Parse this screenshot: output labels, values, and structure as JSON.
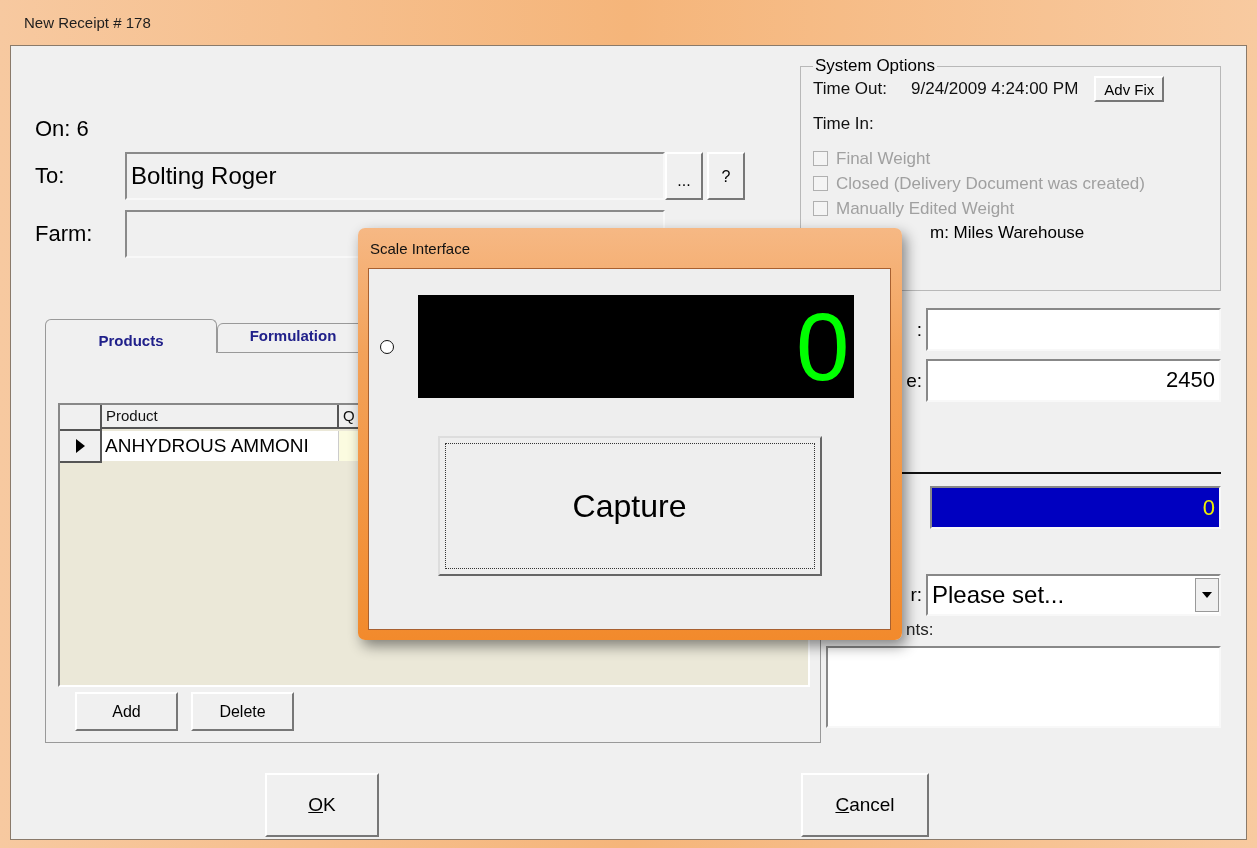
{
  "window": {
    "title": "New Receipt # 178"
  },
  "header": {
    "on_label": "On:",
    "on_value": "6",
    "to_label": "To:",
    "to_value": "Bolting Roger",
    "browse_button": "...",
    "help_button": "?",
    "farm_label": "Farm:"
  },
  "system_options": {
    "title": "System Options",
    "time_out_label": "Time Out:",
    "time_out_value": "9/24/2009 4:24:00 PM",
    "adv_fix_button": "Adv Fix",
    "time_in_label": "Time In:",
    "checkboxes": [
      {
        "label": "Final Weight",
        "checked": false,
        "disabled": true
      },
      {
        "label": "Closed (Delivery Document was created)",
        "checked": false,
        "disabled": true
      },
      {
        "label": "Manually Edited Weight",
        "checked": false,
        "disabled": true
      }
    ],
    "location_text": "m: Miles Warehouse"
  },
  "tabs": [
    {
      "label": "Products",
      "selected": true
    },
    {
      "label": "Formulation",
      "selected": false
    }
  ],
  "grid": {
    "columns": [
      "Product",
      "Q"
    ],
    "rows": [
      {
        "product": "ANHYDROUS AMMONI",
        "selected": true
      }
    ]
  },
  "grid_buttons": [
    "Add",
    "Delete"
  ],
  "right_fields": [
    {
      "kind": "text",
      "label": ":"
    },
    {
      "kind": "number",
      "label": "e:",
      "value": "2450"
    },
    {
      "kind": "rule"
    },
    {
      "kind": "bar",
      "value": "0"
    },
    {
      "kind": "select",
      "label": "r:",
      "value": "Please set..."
    },
    {
      "kind": "textarea",
      "label": "nts:"
    }
  ],
  "buttons": [
    "OK",
    "Cancel"
  ],
  "dialog": {
    "title": "Scale Interface",
    "indicator_selected": false,
    "reading": "0",
    "capture_button": "Capture"
  }
}
